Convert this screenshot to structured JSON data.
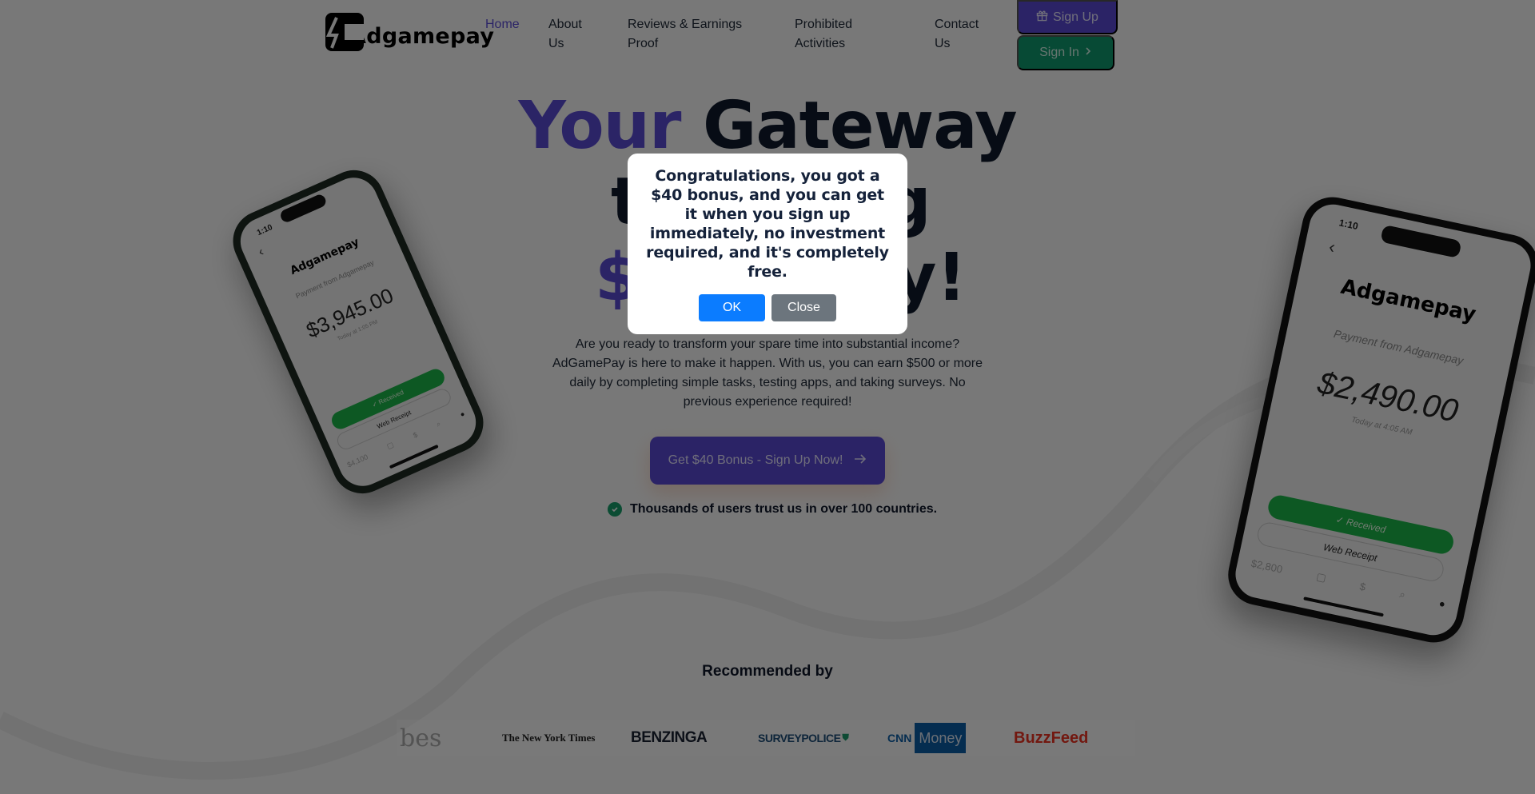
{
  "brand": {
    "name": "Adgamepay"
  },
  "nav": {
    "items": [
      {
        "label": "Home",
        "active": true
      },
      {
        "label": "About Us",
        "active": false
      },
      {
        "label": "Reviews & Earnings Proof",
        "active": false
      },
      {
        "label": "Prohibited Activities",
        "active": false
      },
      {
        "label": "Contact Us",
        "active": false
      }
    ],
    "signup_label": "Sign Up",
    "signin_label": "Sign In"
  },
  "hero": {
    "title_word1": "Your",
    "title_word2": "Gateway",
    "line2_visible_left": "t",
    "line2_visible_right": "g",
    "line3_visible_left": "$",
    "line3_visible_right": "y!",
    "description": "Are you ready to transform your spare time into substantial income? AdGamePay is here to make it happen. With us, you can earn $500 or more daily by completing simple tasks, testing apps, and taking surveys. No previous experience required!",
    "cta_label": "Get $40 Bonus - Sign Up Now!",
    "trust_text": "Thousands of users trust us in over 100 countries."
  },
  "phones": {
    "left": {
      "time": "1:10",
      "brand": "Adgamepay",
      "subtitle": "Payment from Adgamepay",
      "amount": "$3,945.00",
      "date": "Today at 1:05 PM",
      "received": "✓ Received",
      "receipt": "Web Receipt",
      "balance": "$4,100"
    },
    "right": {
      "time": "1:10",
      "brand": "Adgamepay",
      "subtitle": "Payment from Adgamepay",
      "amount": "$2,490.00",
      "date": "Today at 4:05 AM",
      "received": "✓ Received",
      "receipt": "Web Receipt",
      "balance": "$2,800"
    }
  },
  "recommended": {
    "heading": "Recommended by",
    "logos": [
      {
        "name": "Forbes",
        "visible_text": "bes",
        "color": "#9a9a9a"
      },
      {
        "name": "The New York Times",
        "visible_text": "The New York Times",
        "color": "#222222"
      },
      {
        "name": "Benzinga",
        "visible_text": "BENZINGA",
        "color": "#1a2233"
      },
      {
        "name": "SurveyPolice",
        "visible_text": "SURVEYPOLICE",
        "color": "#1f4f7a"
      },
      {
        "name": "CNN Money",
        "visible_text_cnn": "CNN",
        "visible_text_money": "Money",
        "color": "#0b5ea8"
      },
      {
        "name": "BuzzFeed",
        "visible_text": "BuzzFeed",
        "color": "#ee3322"
      }
    ]
  },
  "modal": {
    "message": "Congratulations, you got a $40 bonus, and you can get it when you sign up immediately, no investment required, and it's completely free.",
    "ok_label": "OK",
    "close_label": "Close"
  },
  "colors": {
    "primary_purple": "#5b49d6",
    "signin_green": "#109b6f",
    "ok_blue": "#0b7cff",
    "close_gray": "#6c757d"
  }
}
